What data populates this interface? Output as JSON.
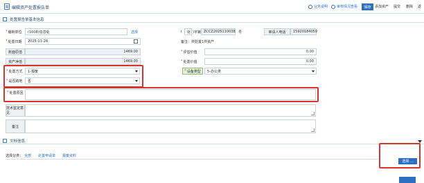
{
  "header": {
    "title": "编辑资产处置报告单",
    "links": [
      "业务说明",
      "审核情况查看"
    ],
    "buttons": {
      "save": "保存",
      "add_asset": "添加资产",
      "submit": "提交",
      "delete": "删除",
      "back": "返"
    }
  },
  "section_basic": {
    "title": "处置报告单基本信息"
  },
  "form": {
    "unit_label": "编制单位",
    "unit_value": "(1008)信息处",
    "select_link": "选择",
    "doc_prefix": "(",
    "doc_char": "处",
    "doc_after": ")字第",
    "doc_number": "ZCCZ2025110038",
    "doc_suffix": "号",
    "approval_label": "审请人电话",
    "approval_value": "15920184059",
    "date_label": "处置日期",
    "date_value": "2025-11-24",
    "remark": "备注：共处置1件资产",
    "book_value_label": "账面原值",
    "book_value": "1469.00",
    "eval_label": "评估价值",
    "eval_value": "0.00",
    "net_label": "资产净值",
    "net_value": "1469.00",
    "disposal_value_label": "处置价值",
    "disposal_value": "0.00",
    "method_label": "处置方式",
    "method_value": "1-报废",
    "type_label": "设备类型",
    "type_value": "5-办公类",
    "remote_label": "是否跨地",
    "remote_value": "否",
    "reason_label": "处置原因",
    "reason_value": "",
    "tech_label": "技术鉴定意见",
    "tech_value": "",
    "note_label": "备注",
    "note_value": ""
  },
  "section_docs": {
    "title": "文档信息"
  },
  "docs": {
    "category_label": "选择分类：",
    "tabs": [
      "全部",
      "处置申请单",
      "报废资料"
    ],
    "select_button": "选择 ..."
  }
}
